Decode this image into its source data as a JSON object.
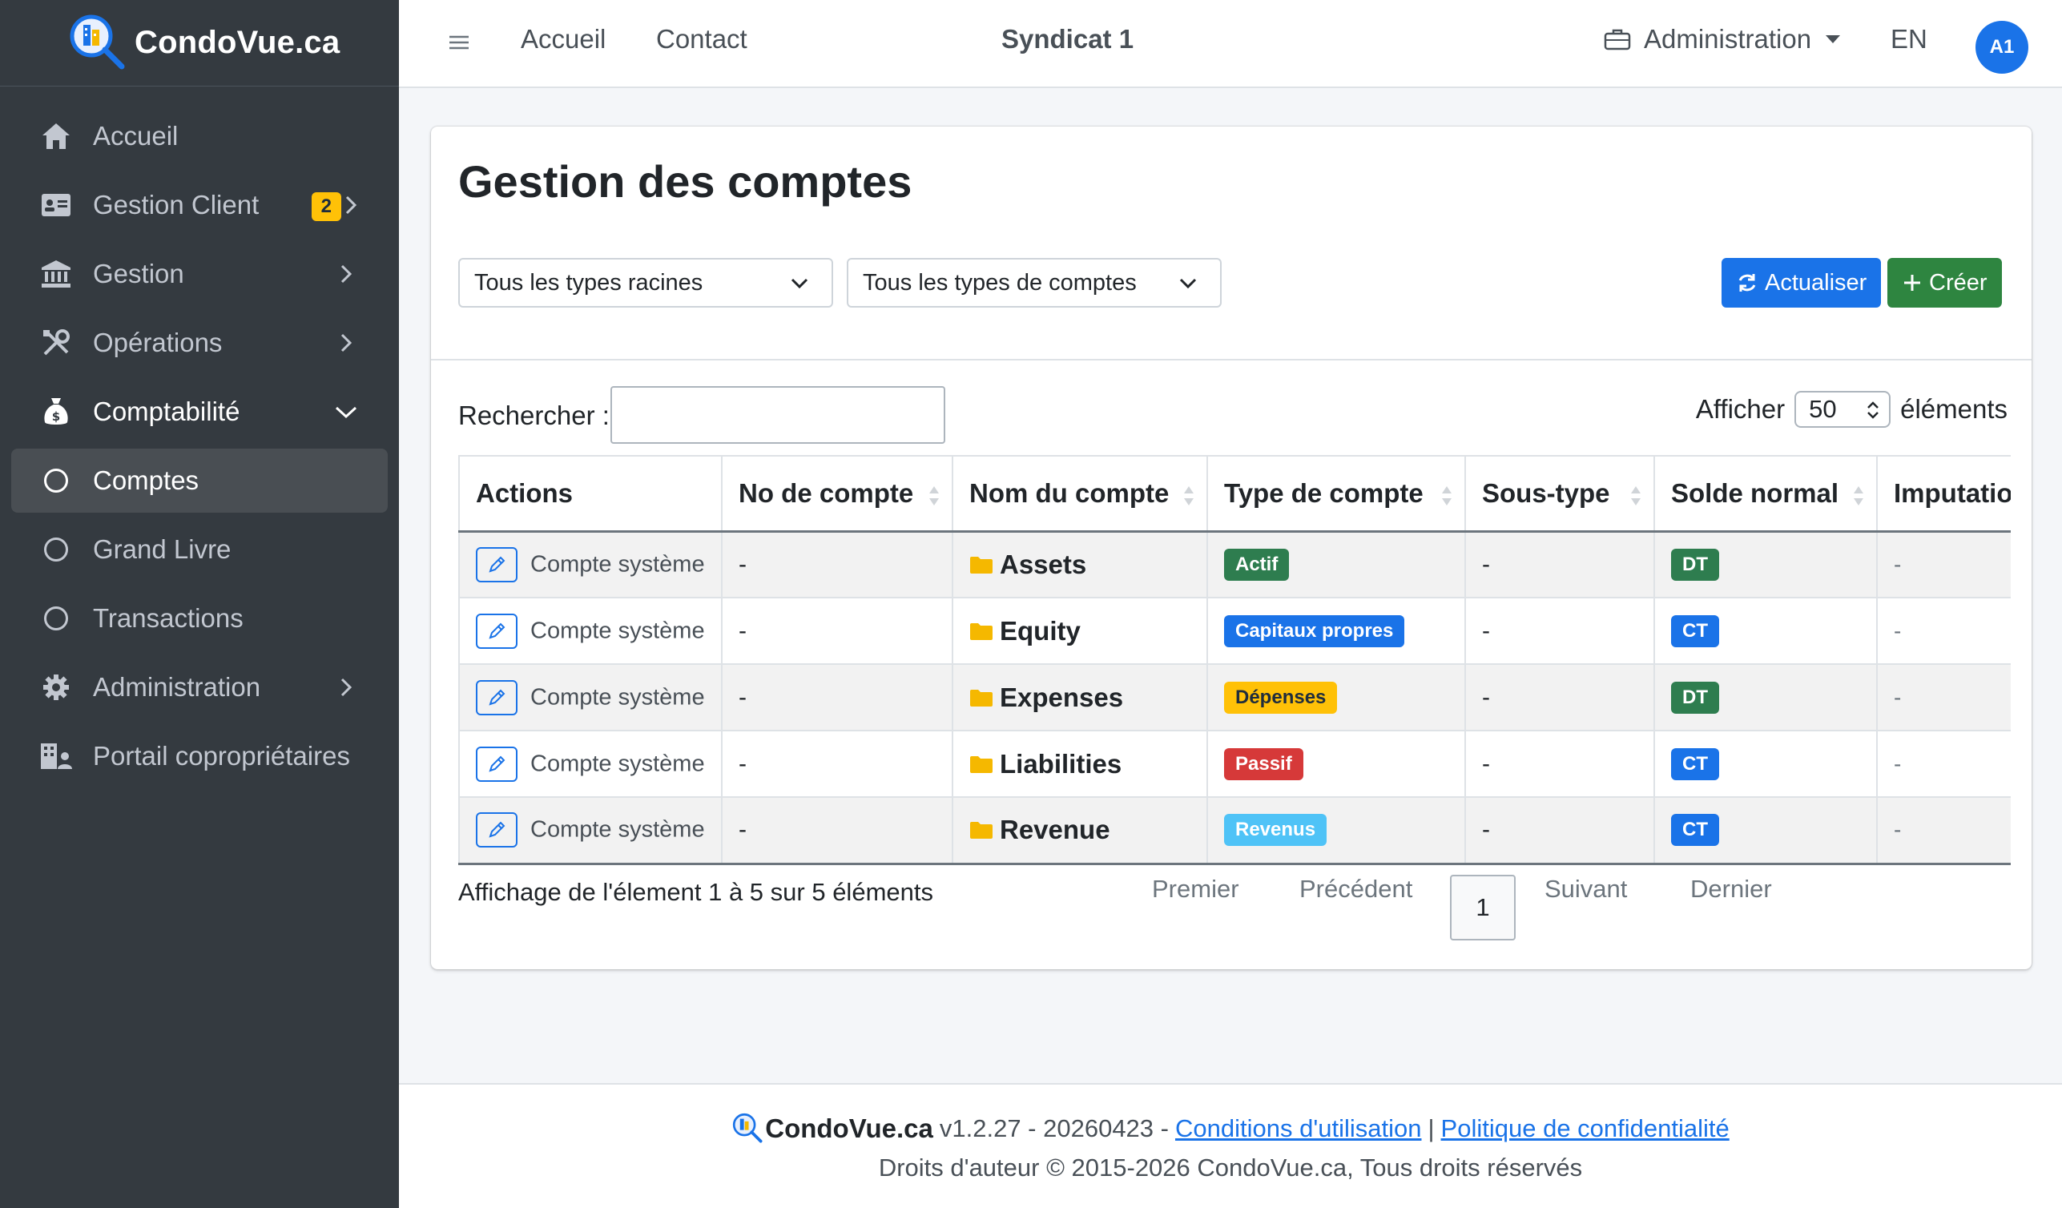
{
  "brand": {
    "name": "CondoVue.ca"
  },
  "sidebar": {
    "items": [
      {
        "label": "Accueil",
        "icon": "home-icon"
      },
      {
        "label": "Gestion Client",
        "icon": "id-card-icon",
        "badge": "2"
      },
      {
        "label": "Gestion",
        "icon": "bank-icon"
      },
      {
        "label": "Opérations",
        "icon": "tools-icon"
      },
      {
        "label": "Comptabilité",
        "icon": "money-bag-icon"
      },
      {
        "label": "Comptes",
        "icon": "circle-icon"
      },
      {
        "label": "Grand Livre",
        "icon": "circle-icon"
      },
      {
        "label": "Transactions",
        "icon": "circle-icon"
      },
      {
        "label": "Administration",
        "icon": "gear-icon"
      },
      {
        "label": "Portail copropriétaires",
        "icon": "building-user-icon"
      }
    ]
  },
  "topbar": {
    "links": [
      "Accueil",
      "Contact"
    ],
    "center": "Syndicat 1",
    "admin": "Administration",
    "lang": "EN",
    "avatar": "A1"
  },
  "page": {
    "title": "Gestion des comptes",
    "filter_root": "Tous les types racines",
    "filter_type": "Tous les types de comptes",
    "refresh_label": "Actualiser",
    "create_label": "Créer",
    "search_label": "Rechercher :",
    "search_value": "",
    "length_prefix": "Afficher",
    "length_value": "50",
    "length_suffix": "éléments"
  },
  "table": {
    "columns": [
      "Actions",
      "No de compte",
      "Nom du compte",
      "Type de compte",
      "Sous-type",
      "Solde normal",
      "Imputation"
    ],
    "rows": [
      {
        "action": "Compte système",
        "number": "-",
        "name": "Assets",
        "type": "Actif",
        "subtype": "-",
        "normal": "DT",
        "imputation": "-"
      },
      {
        "action": "Compte système",
        "number": "-",
        "name": "Equity",
        "type": "Capitaux propres",
        "subtype": "-",
        "normal": "CT",
        "imputation": "-"
      },
      {
        "action": "Compte système",
        "number": "-",
        "name": "Expenses",
        "type": "Dépenses",
        "subtype": "-",
        "normal": "DT",
        "imputation": "-"
      },
      {
        "action": "Compte système",
        "number": "-",
        "name": "Liabilities",
        "type": "Passif",
        "subtype": "-",
        "normal": "CT",
        "imputation": "-"
      },
      {
        "action": "Compte système",
        "number": "-",
        "name": "Revenue",
        "type": "Revenus",
        "subtype": "-",
        "normal": "CT",
        "imputation": "-"
      }
    ],
    "info": "Affichage de l'élement 1 à 5 sur 5 éléments"
  },
  "pagination": {
    "first": "Premier",
    "prev": "Précédent",
    "current": "1",
    "next": "Suivant",
    "last": "Dernier"
  },
  "footer": {
    "brand": "CondoVue.ca",
    "version": "v1.2.27 - 20260423 -",
    "terms": "Conditions d'utilisation",
    "separator": "|",
    "privacy": "Politique de confidentialité",
    "copyright": "Droits d'auteur © 2015-2026 CondoVue.ca, Tous droits réservés"
  },
  "colors": {
    "sidebar_bg": "#343a40",
    "primary": "#1a73e8",
    "success": "#2e8540",
    "badge_actif": "#2e7d4f",
    "badge_capitaux": "#1a73e8",
    "badge_depenses": "#ffc107",
    "badge_passif": "#d63939",
    "badge_revenus": "#4fc3f7",
    "badge_dt": "#2e7d4f",
    "badge_ct": "#1a73e8",
    "folder": "#f5b800"
  }
}
